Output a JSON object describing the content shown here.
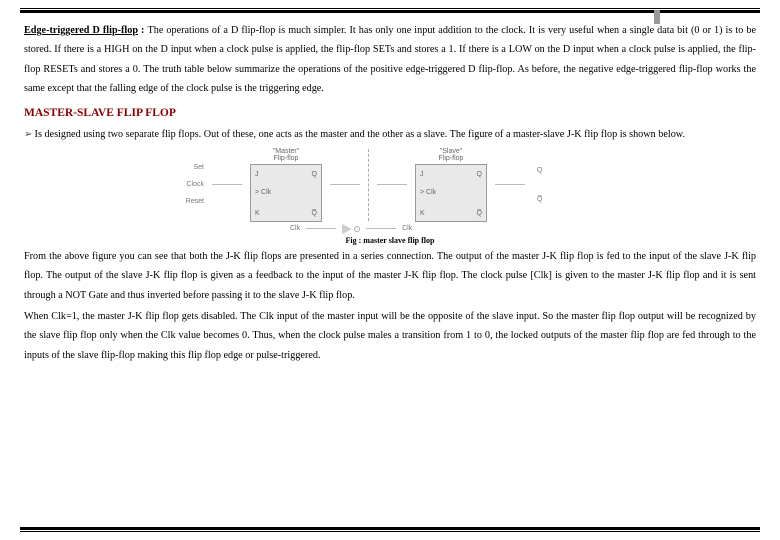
{
  "section_d": {
    "title": "Edge-triggered D flip-flop",
    "colon": " : ",
    "body": "The operations of a D flip-flop is much simpler. It has only one input addition to the clock. It is very useful when a single data bit (0 or 1) is to be stored.    If there is a HIGH on the D input when a clock pulse is applied, the flip-flop SETs and stores a 1. If there is a LOW on the D input when a clock pulse is applied, the flip-flop RESETs and stores a 0. The truth table below summarize the operations of the positive edge-triggered D flip-flop. As before, the negative edge-triggered flip-flop works the same except that the falling edge of the clock pulse is the triggering edge."
  },
  "ms": {
    "heading": "MASTER-SLAVE FLIP FLOP",
    "bullet": "Is designed using two separate flip flops. Out of these, one acts as the master and the other as a slave. The figure of a master-slave J-K flip flop is shown below."
  },
  "figure": {
    "master_title": "\"Master\"\nFlip-flop",
    "slave_title": "\"Slave\"\nFlip-flop",
    "left_labels": {
      "set": "Set",
      "clock": "Clock",
      "reset": "Reset"
    },
    "pins": {
      "j": "J",
      "clk": "> Clk",
      "k": "K",
      "q": "Q",
      "qbar": "Q̅"
    },
    "right_labels": {
      "q": "Q",
      "qbar": "Q̅"
    },
    "clk_row": {
      "clk1": "Clk",
      "clk2": "Clk"
    },
    "caption": "Fig : master slave flip flop"
  },
  "below": {
    "p1": "From the above figure you can see that both the J-K flip flops are presented in a series connection. The output of the master J-K flip flop is fed to the input of the slave J-K flip flop. The output of the slave J-K flip flop is given as a feedback to the input of the master J-K flip flop. The clock pulse [Clk] is given to the master J-K flip flop and it is sent through a NOT Gate and thus inverted before passing it to the slave J-K flip flop.",
    "p2": "When Clk=1, the master J-K flip flop gets disabled. The Clk input of the master input will be the opposite of the slave input. So the master flip flop output will be recognized by the slave flip flop only when the Clk value becomes 0. Thus, when the clock pulse males a transition from 1 to 0, the locked outputs of the master flip flop are fed through to the inputs of the slave flip-flop making this flip flop edge or pulse-triggered."
  }
}
